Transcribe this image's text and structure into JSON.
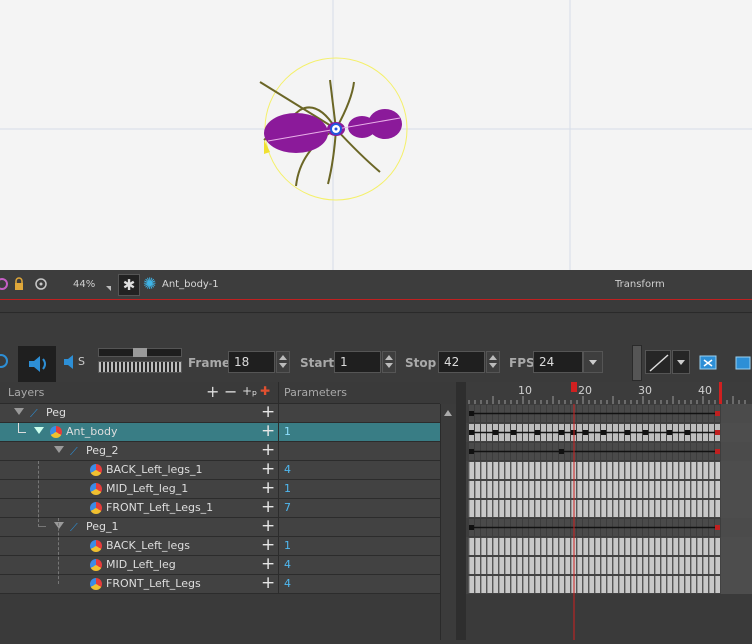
{
  "camera_toolbar": {
    "zoom": "44%",
    "layer_name": "Ant_body-1",
    "view_title": "Transform"
  },
  "playback": {
    "frame_label": "Frame",
    "frame_value": "18",
    "start_label": "Start",
    "start_value": "1",
    "stop_label": "Stop",
    "stop_value": "42",
    "fps_label": "FPS",
    "fps_value": "24",
    "sound_s_label": "S"
  },
  "layers_panel": {
    "title": "Layers",
    "parameters_label": "Parameters",
    "rows": [
      {
        "name": "Peg",
        "type": "peg",
        "param": ""
      },
      {
        "name": "Ant_body",
        "type": "drawing",
        "param": "1",
        "selected": true
      },
      {
        "name": "Peg_2",
        "type": "peg",
        "param": ""
      },
      {
        "name": "BACK_Left_legs_1",
        "type": "drawing",
        "param": "4"
      },
      {
        "name": "MID_Left_leg_1",
        "type": "drawing",
        "param": "1"
      },
      {
        "name": "FRONT_Left_Legs_1",
        "type": "drawing",
        "param": "7"
      },
      {
        "name": "Peg_1",
        "type": "peg",
        "param": ""
      },
      {
        "name": "BACK_Left_legs",
        "type": "drawing",
        "param": "1"
      },
      {
        "name": "MID_Left_leg",
        "type": "drawing",
        "param": "4"
      },
      {
        "name": "FRONT_Left_Legs",
        "type": "drawing",
        "param": "4"
      }
    ]
  },
  "timeline": {
    "ruler_labels": [
      "10",
      "20",
      "30",
      "40"
    ],
    "current_frame": 18,
    "last_frame": 42
  },
  "colors": {
    "selection": "#397d85",
    "playhead": "#d02020",
    "param_value": "#4fb8f0",
    "ant_body": "#8b1a9a",
    "accent_blue": "#2d8fd6"
  }
}
